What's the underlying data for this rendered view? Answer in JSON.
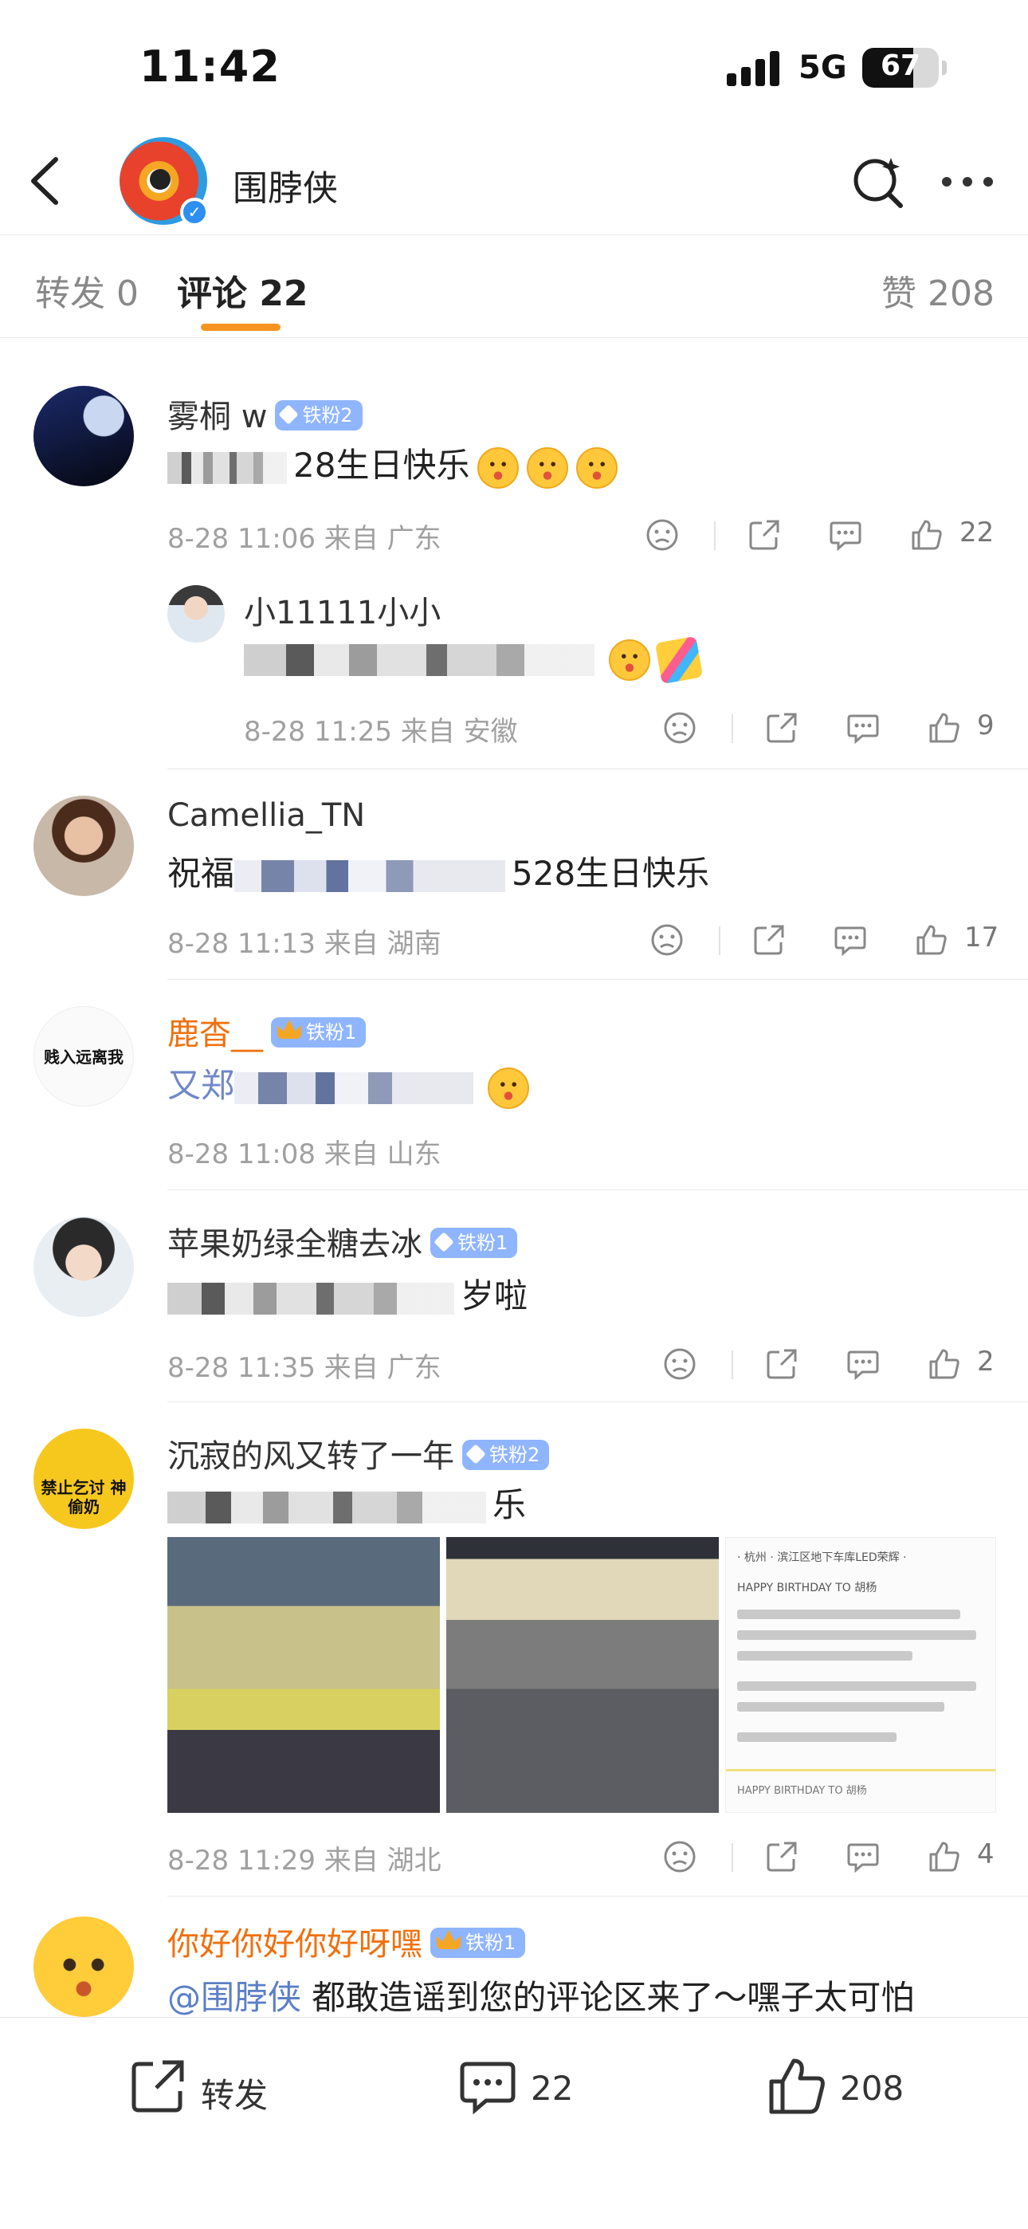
{
  "status_bar": {
    "time": "11:42",
    "network": "5G",
    "battery": "67",
    "battery_level": 0.67
  },
  "nav": {
    "title": "围脖侠"
  },
  "tabs": {
    "repost": "转发 0",
    "comments": "评论 22",
    "likes": "赞 208"
  },
  "comments": [
    {
      "name": "雾桐 w",
      "badge": "铁粉2",
      "text_tail": "28生日快乐",
      "time": "8-28 11:06",
      "source": "来自 广东",
      "likes": "22",
      "reply": {
        "name": "小11111小小",
        "time": "8-28 11:25",
        "source": "来自 安徽",
        "likes": "9"
      }
    },
    {
      "name": "Camellia_TN",
      "text_head": "祝福",
      "text_tail": "528生日快乐",
      "time": "8-28 11:13",
      "source": "来自 湖南",
      "likes": "17"
    },
    {
      "name": "鹿杳__",
      "badge": "铁粉1",
      "avatar_text": "贱入远离我",
      "text_head": "又郑",
      "time": "8-28 11:08",
      "source": "来自 山东",
      "likes": ""
    },
    {
      "name": "苹果奶绿全糖去冰",
      "badge": "铁粉1",
      "text_tail": "岁啦",
      "time": "8-28 11:35",
      "source": "来自 广东",
      "likes": "2"
    },
    {
      "name": "沉寂的风又转了一年",
      "badge": "铁粉2",
      "avatar_text": "禁止乞讨 神偷奶",
      "text_tail": "乐",
      "time": "8-28 11:29",
      "source": "来自 湖北",
      "likes": "4",
      "image3": {
        "l1": "· 杭州 · 滨江区地下车库LED荣辉 ·",
        "l2": "HAPPY BIRTHDAY TO 胡杨",
        "l3": "HAPPY BIRTHDAY TO 胡杨"
      }
    },
    {
      "name": "你好你好你好呀嘿",
      "badge": "铁粉1",
      "mention": "@围脖侠",
      "text": " 都敢造谣到您的评论区来了～嘿子太可怕"
    }
  ],
  "bottom_bar": {
    "repost": "转发",
    "comments": "22",
    "likes": "208"
  },
  "colors": {
    "accent_orange": "#f7931e",
    "badge_blue": "#8fb5ff",
    "name_orange": "#f0700d",
    "verified_blue": "#2d8ff0"
  }
}
